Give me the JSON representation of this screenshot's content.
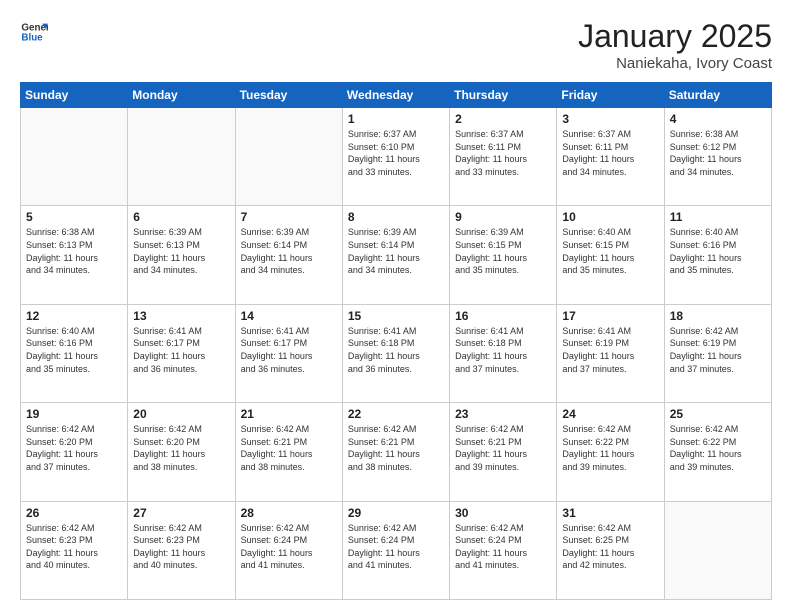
{
  "header": {
    "logo_general": "General",
    "logo_blue": "Blue",
    "month_title": "January 2025",
    "location": "Naniekaha, Ivory Coast"
  },
  "days_of_week": [
    "Sunday",
    "Monday",
    "Tuesday",
    "Wednesday",
    "Thursday",
    "Friday",
    "Saturday"
  ],
  "weeks": [
    [
      {
        "day": "",
        "info": ""
      },
      {
        "day": "",
        "info": ""
      },
      {
        "day": "",
        "info": ""
      },
      {
        "day": "1",
        "info": "Sunrise: 6:37 AM\nSunset: 6:10 PM\nDaylight: 11 hours\nand 33 minutes."
      },
      {
        "day": "2",
        "info": "Sunrise: 6:37 AM\nSunset: 6:11 PM\nDaylight: 11 hours\nand 33 minutes."
      },
      {
        "day": "3",
        "info": "Sunrise: 6:37 AM\nSunset: 6:11 PM\nDaylight: 11 hours\nand 34 minutes."
      },
      {
        "day": "4",
        "info": "Sunrise: 6:38 AM\nSunset: 6:12 PM\nDaylight: 11 hours\nand 34 minutes."
      }
    ],
    [
      {
        "day": "5",
        "info": "Sunrise: 6:38 AM\nSunset: 6:13 PM\nDaylight: 11 hours\nand 34 minutes."
      },
      {
        "day": "6",
        "info": "Sunrise: 6:39 AM\nSunset: 6:13 PM\nDaylight: 11 hours\nand 34 minutes."
      },
      {
        "day": "7",
        "info": "Sunrise: 6:39 AM\nSunset: 6:14 PM\nDaylight: 11 hours\nand 34 minutes."
      },
      {
        "day": "8",
        "info": "Sunrise: 6:39 AM\nSunset: 6:14 PM\nDaylight: 11 hours\nand 34 minutes."
      },
      {
        "day": "9",
        "info": "Sunrise: 6:39 AM\nSunset: 6:15 PM\nDaylight: 11 hours\nand 35 minutes."
      },
      {
        "day": "10",
        "info": "Sunrise: 6:40 AM\nSunset: 6:15 PM\nDaylight: 11 hours\nand 35 minutes."
      },
      {
        "day": "11",
        "info": "Sunrise: 6:40 AM\nSunset: 6:16 PM\nDaylight: 11 hours\nand 35 minutes."
      }
    ],
    [
      {
        "day": "12",
        "info": "Sunrise: 6:40 AM\nSunset: 6:16 PM\nDaylight: 11 hours\nand 35 minutes."
      },
      {
        "day": "13",
        "info": "Sunrise: 6:41 AM\nSunset: 6:17 PM\nDaylight: 11 hours\nand 36 minutes."
      },
      {
        "day": "14",
        "info": "Sunrise: 6:41 AM\nSunset: 6:17 PM\nDaylight: 11 hours\nand 36 minutes."
      },
      {
        "day": "15",
        "info": "Sunrise: 6:41 AM\nSunset: 6:18 PM\nDaylight: 11 hours\nand 36 minutes."
      },
      {
        "day": "16",
        "info": "Sunrise: 6:41 AM\nSunset: 6:18 PM\nDaylight: 11 hours\nand 37 minutes."
      },
      {
        "day": "17",
        "info": "Sunrise: 6:41 AM\nSunset: 6:19 PM\nDaylight: 11 hours\nand 37 minutes."
      },
      {
        "day": "18",
        "info": "Sunrise: 6:42 AM\nSunset: 6:19 PM\nDaylight: 11 hours\nand 37 minutes."
      }
    ],
    [
      {
        "day": "19",
        "info": "Sunrise: 6:42 AM\nSunset: 6:20 PM\nDaylight: 11 hours\nand 37 minutes."
      },
      {
        "day": "20",
        "info": "Sunrise: 6:42 AM\nSunset: 6:20 PM\nDaylight: 11 hours\nand 38 minutes."
      },
      {
        "day": "21",
        "info": "Sunrise: 6:42 AM\nSunset: 6:21 PM\nDaylight: 11 hours\nand 38 minutes."
      },
      {
        "day": "22",
        "info": "Sunrise: 6:42 AM\nSunset: 6:21 PM\nDaylight: 11 hours\nand 38 minutes."
      },
      {
        "day": "23",
        "info": "Sunrise: 6:42 AM\nSunset: 6:21 PM\nDaylight: 11 hours\nand 39 minutes."
      },
      {
        "day": "24",
        "info": "Sunrise: 6:42 AM\nSunset: 6:22 PM\nDaylight: 11 hours\nand 39 minutes."
      },
      {
        "day": "25",
        "info": "Sunrise: 6:42 AM\nSunset: 6:22 PM\nDaylight: 11 hours\nand 39 minutes."
      }
    ],
    [
      {
        "day": "26",
        "info": "Sunrise: 6:42 AM\nSunset: 6:23 PM\nDaylight: 11 hours\nand 40 minutes."
      },
      {
        "day": "27",
        "info": "Sunrise: 6:42 AM\nSunset: 6:23 PM\nDaylight: 11 hours\nand 40 minutes."
      },
      {
        "day": "28",
        "info": "Sunrise: 6:42 AM\nSunset: 6:24 PM\nDaylight: 11 hours\nand 41 minutes."
      },
      {
        "day": "29",
        "info": "Sunrise: 6:42 AM\nSunset: 6:24 PM\nDaylight: 11 hours\nand 41 minutes."
      },
      {
        "day": "30",
        "info": "Sunrise: 6:42 AM\nSunset: 6:24 PM\nDaylight: 11 hours\nand 41 minutes."
      },
      {
        "day": "31",
        "info": "Sunrise: 6:42 AM\nSunset: 6:25 PM\nDaylight: 11 hours\nand 42 minutes."
      },
      {
        "day": "",
        "info": ""
      }
    ]
  ]
}
